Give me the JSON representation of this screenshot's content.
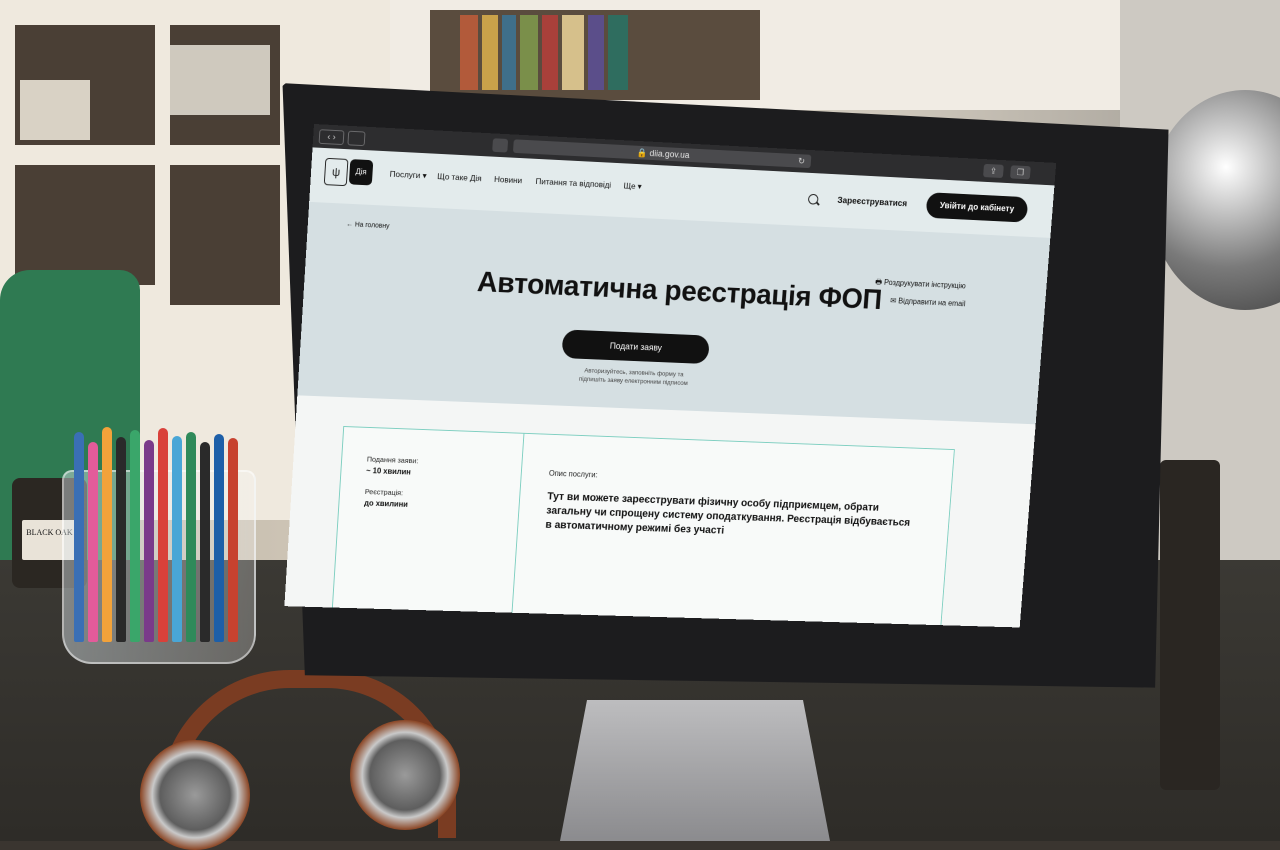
{
  "browser": {
    "url": "diia.gov.ua"
  },
  "header": {
    "logo_text": "Дія",
    "nav": [
      {
        "label": "Послуги ▾"
      },
      {
        "label": "Що таке Дія"
      },
      {
        "label": "Новини"
      },
      {
        "label": "Питання та відповіді"
      },
      {
        "label": "Ще ▾"
      }
    ],
    "register_label": "Зареєструватися",
    "login_label": "Увійти до кабінету"
  },
  "hero": {
    "back_label": "← На головну",
    "print_label": "🖶  Роздрукувати інструкцію",
    "email_label": "✉  Відправити на email",
    "title": "Автоматична реєстрація ФОП",
    "apply_label": "Подати заяву",
    "hint_line1": "Авторизуйтесь, заповніть форму та",
    "hint_line2": "підпишіть заяву електронним підписом"
  },
  "info": {
    "submission_label": "Подання заяви:",
    "submission_value": "~ 10 хвилин",
    "registration_label": "Реєстрація:",
    "registration_value": "до хвилини",
    "description_label": "Опис послуги:",
    "description_text": "Тут ви можете зареєструвати фізичну особу підприємцем, обрати загальну чи спрощену систему оподаткування. Реєстрація відбувається в автоматичному режимі без участі"
  },
  "scene": {
    "jar_label": "BLACK OAK"
  },
  "colors": {
    "brand_dark": "#111111",
    "hero_bg": "#d5dfe2",
    "accent_border": "#7fcfc1"
  }
}
